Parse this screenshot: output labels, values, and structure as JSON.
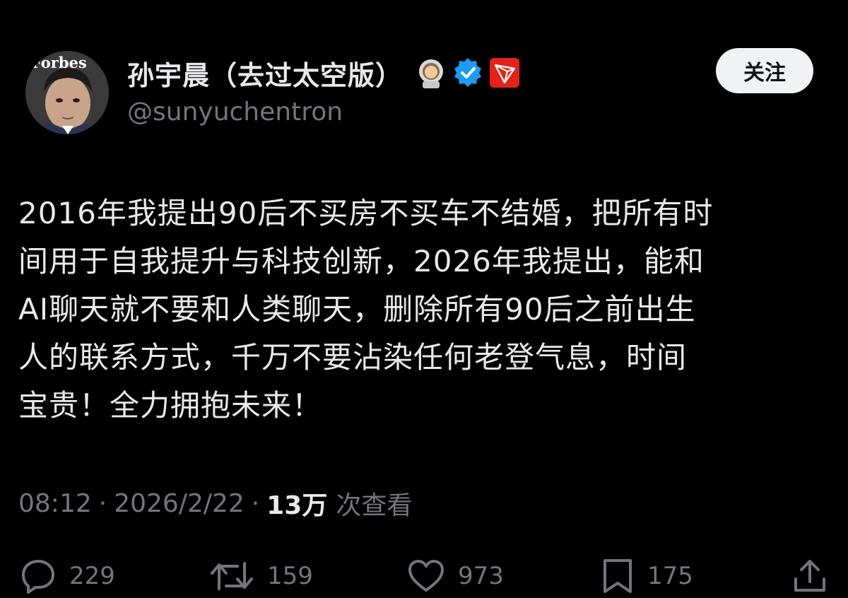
{
  "author": {
    "avatar_text": "Forbes",
    "display_name": "孙宇晨（去过太空版）",
    "handle": "@sunyuchentron",
    "badges": [
      "astronaut-emoji-icon",
      "verified-badge-icon",
      "tron-logo-icon"
    ]
  },
  "follow_button": {
    "label": "关注"
  },
  "tweet": {
    "lines": [
      "2016年我提出90后不买房不买车不结婚，把所有时",
      "间用于自我提升与科技创新，2026年我提出，能和",
      "AI聊天就不要和人类聊天，删除所有90后之前出生",
      "人的联系方式，千万不要沾染任何老登气息，时间",
      "宝贵！全力拥抱未来！"
    ]
  },
  "meta": {
    "time": "08:12",
    "separator": "·",
    "date": "2026/2/22",
    "views_count": "13万",
    "views_label": "次查看"
  },
  "actions": {
    "replies": "229",
    "reposts": "159",
    "likes": "973",
    "bookmarks": "175"
  },
  "colors": {
    "background": "#000000",
    "text": "#e7e9ea",
    "muted": "#71767b",
    "verified": "#1d9bf0",
    "tron": "#e2231a",
    "follow_bg": "#eff3f4"
  }
}
